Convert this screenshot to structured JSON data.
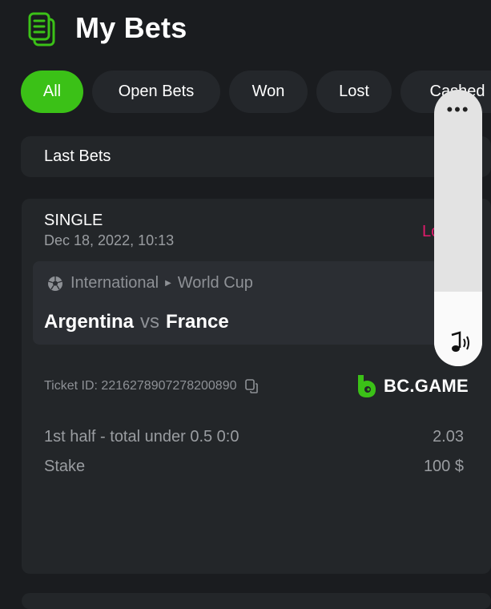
{
  "header": {
    "title": "My Bets",
    "icon": "document-icon"
  },
  "filters": [
    {
      "label": "All",
      "active": true
    },
    {
      "label": "Open Bets",
      "active": false
    },
    {
      "label": "Won",
      "active": false
    },
    {
      "label": "Lost",
      "active": false
    },
    {
      "label": "Cashed",
      "active": false
    }
  ],
  "section": {
    "label": "Last Bets"
  },
  "bet": {
    "type": "SINGLE",
    "date": "Dec 18, 2022, 10:13",
    "status": "Lost",
    "league": "International",
    "competition": "World Cup",
    "team_home": "Argentina",
    "vs": "vs",
    "team_away": "France",
    "ticket": "Ticket ID: 2216278907278200890",
    "brand": "BC.GAME",
    "selection": "1st half - total under 0.5   0:0",
    "odds": "2.03",
    "stake_label": "Stake",
    "stake_value": "100 $"
  },
  "panel": {
    "more": "•••"
  },
  "colors": {
    "accent": "#3bc117",
    "lost": "#e21a6c",
    "background": "#1a1c1f",
    "card": "#232629"
  }
}
